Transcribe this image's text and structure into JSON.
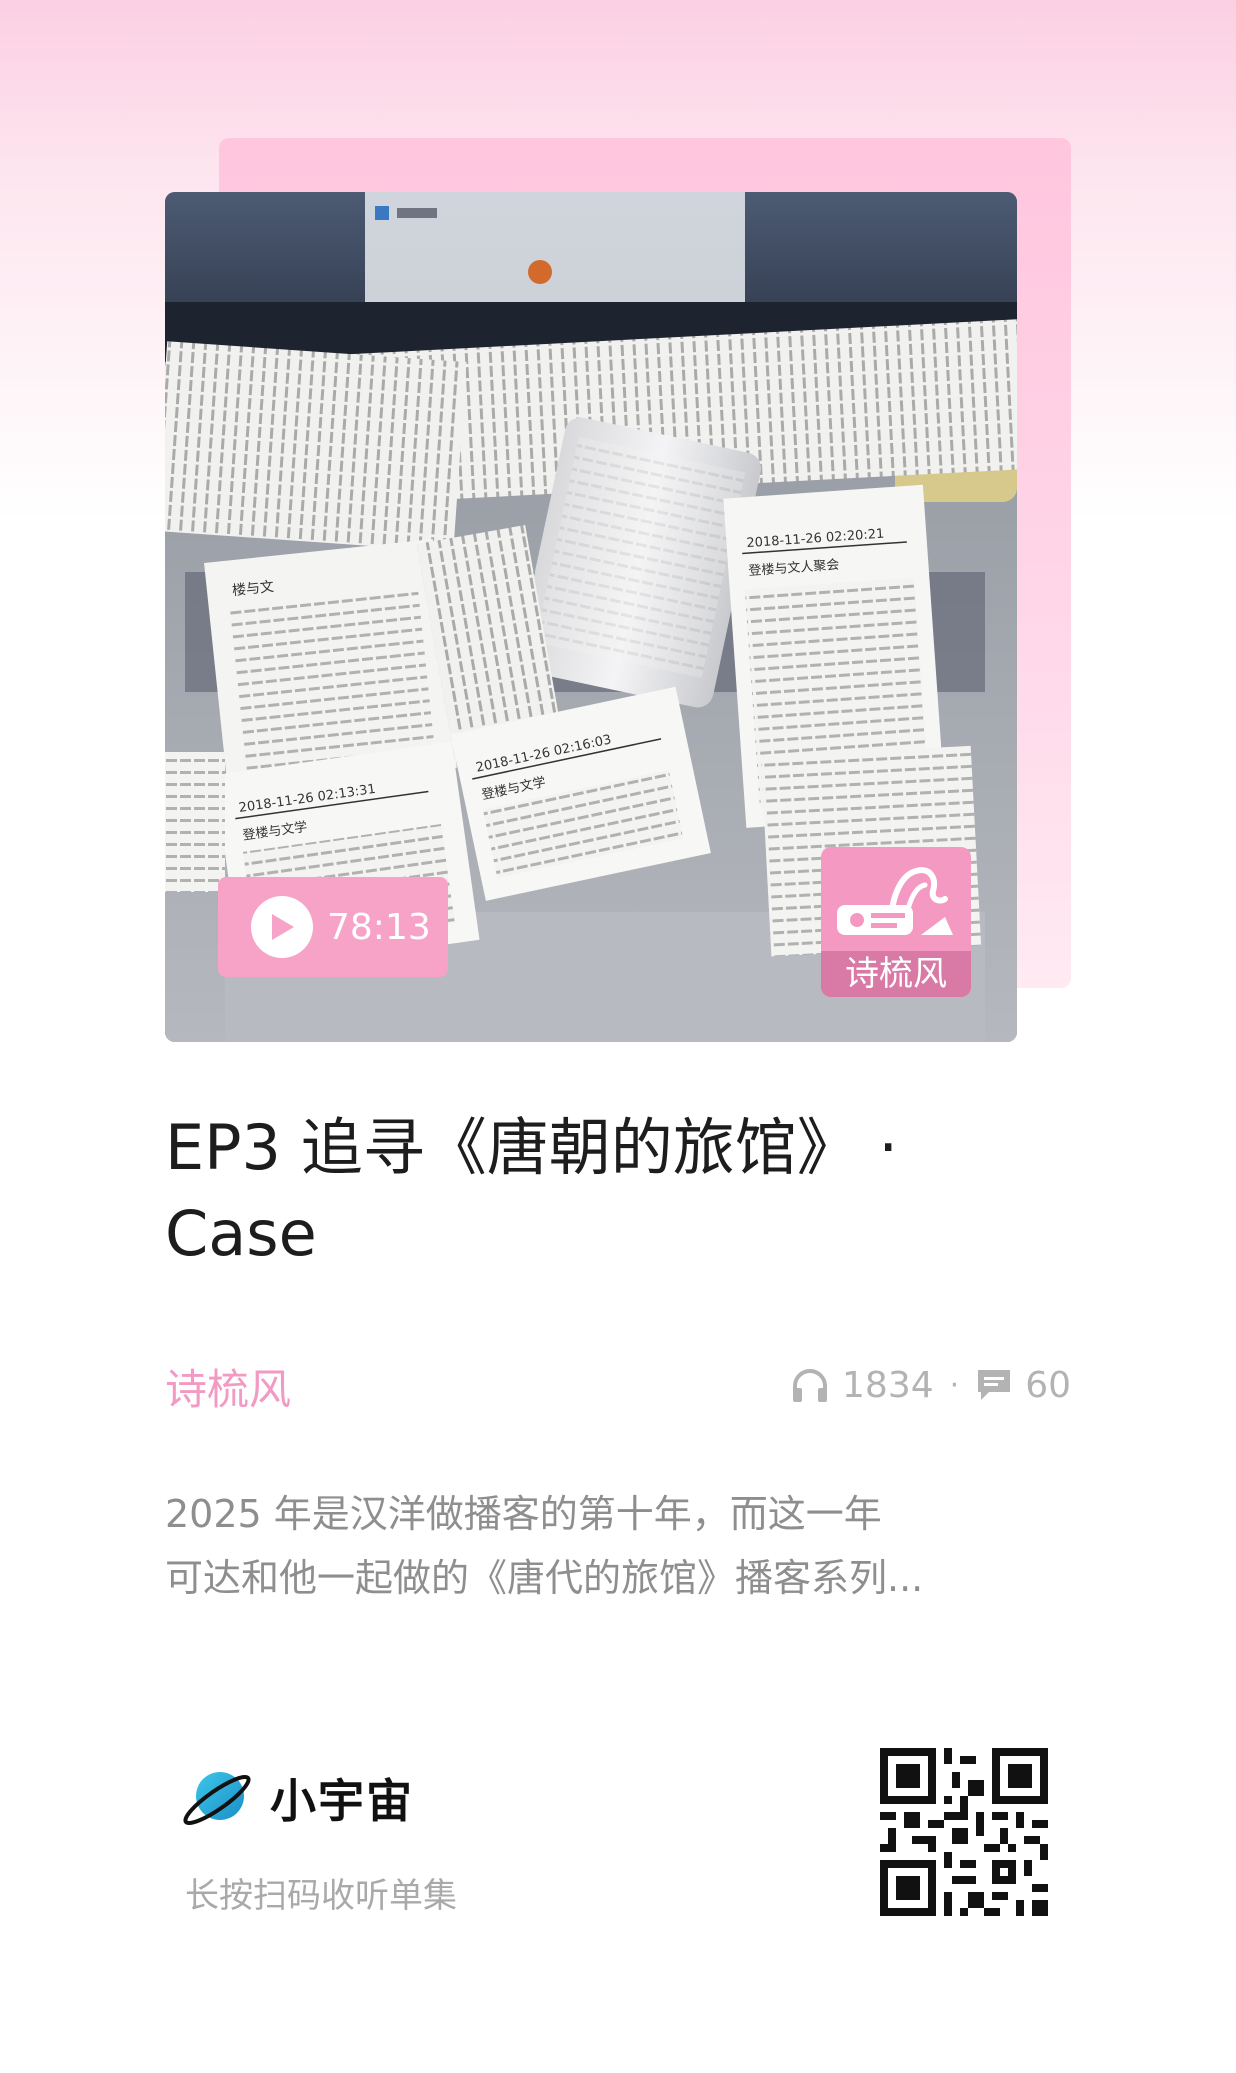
{
  "cover": {
    "duration": "78:13",
    "badge_label": "诗梳风",
    "receipts": [
      {
        "date": "2018-11-26 02:20:21",
        "heading": "登楼与文人聚会"
      },
      {
        "date": "2018-11-26 02:13:31",
        "heading": "登楼与文学"
      },
      {
        "date": "2018-11-26 02:16:03",
        "heading": "登楼与文学"
      },
      {
        "date": "",
        "heading": "楼与文"
      }
    ]
  },
  "episode": {
    "title_line1": "EP3 追寻《唐朝的旅馆》 ·",
    "title_line2": "Case"
  },
  "podcast": {
    "name": "诗梳风"
  },
  "stats": {
    "plays": "1834",
    "separator": "·",
    "comments": "60",
    "headphones_icon": "headphones-icon",
    "comment_icon": "comment-icon"
  },
  "description": {
    "line1": "2025 年是汉洋做播客的第十年，而这一年",
    "line2": "可达和他一起做的《唐代的旅馆》播客系列..."
  },
  "footer": {
    "brand_name": "小宇宙",
    "hint": "长按扫码收听单集"
  },
  "colors": {
    "accent_pink": "#f39ac4",
    "play_pill": "#f7a3c8",
    "title_text": "#1d1d1d",
    "muted_text": "#8e8e8e"
  }
}
